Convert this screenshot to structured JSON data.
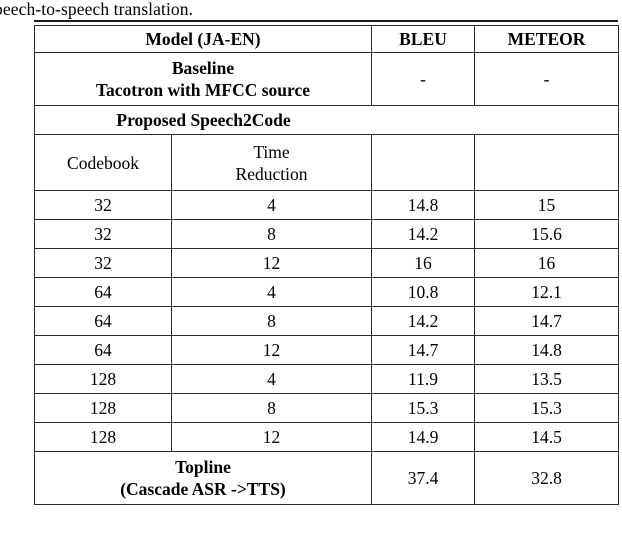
{
  "page": {
    "body_text_above_table": "peech-to-speech translation."
  },
  "table": {
    "header": {
      "model": "Model (JA-EN)",
      "bleu": "BLEU",
      "meteor": "METEOR"
    },
    "baseline": {
      "title_line1": "Baseline",
      "title_line2": "Tacotron with MFCC source",
      "bleu": "-",
      "meteor": "-"
    },
    "section": {
      "label": "Proposed Speech2Code"
    },
    "subheader": {
      "codebook": "Codebook",
      "time_reduction_line1": "Time",
      "time_reduction_line2": "Reduction",
      "bleu": "",
      "meteor": ""
    },
    "columns": [
      "Codebook",
      "Time Reduction",
      "BLEU",
      "METEOR"
    ],
    "rows": [
      {
        "codebook": "32",
        "time_reduction": "4",
        "bleu": "14.8",
        "meteor": "15"
      },
      {
        "codebook": "32",
        "time_reduction": "8",
        "bleu": "14.2",
        "meteor": "15.6"
      },
      {
        "codebook": "32",
        "time_reduction": "12",
        "bleu": "16",
        "meteor": "16"
      },
      {
        "codebook": "64",
        "time_reduction": "4",
        "bleu": "10.8",
        "meteor": "12.1"
      },
      {
        "codebook": "64",
        "time_reduction": "8",
        "bleu": "14.2",
        "meteor": "14.7"
      },
      {
        "codebook": "64",
        "time_reduction": "12",
        "bleu": "14.7",
        "meteor": "14.8"
      },
      {
        "codebook": "128",
        "time_reduction": "4",
        "bleu": "11.9",
        "meteor": "13.5"
      },
      {
        "codebook": "128",
        "time_reduction": "8",
        "bleu": "15.3",
        "meteor": "15.3"
      },
      {
        "codebook": "128",
        "time_reduction": "12",
        "bleu": "14.9",
        "meteor": "14.5"
      }
    ],
    "topline": {
      "title_line1": "Topline",
      "title_line2": "(Cascade ASR ->TTS)",
      "bleu": "37.4",
      "meteor": "32.8"
    }
  }
}
